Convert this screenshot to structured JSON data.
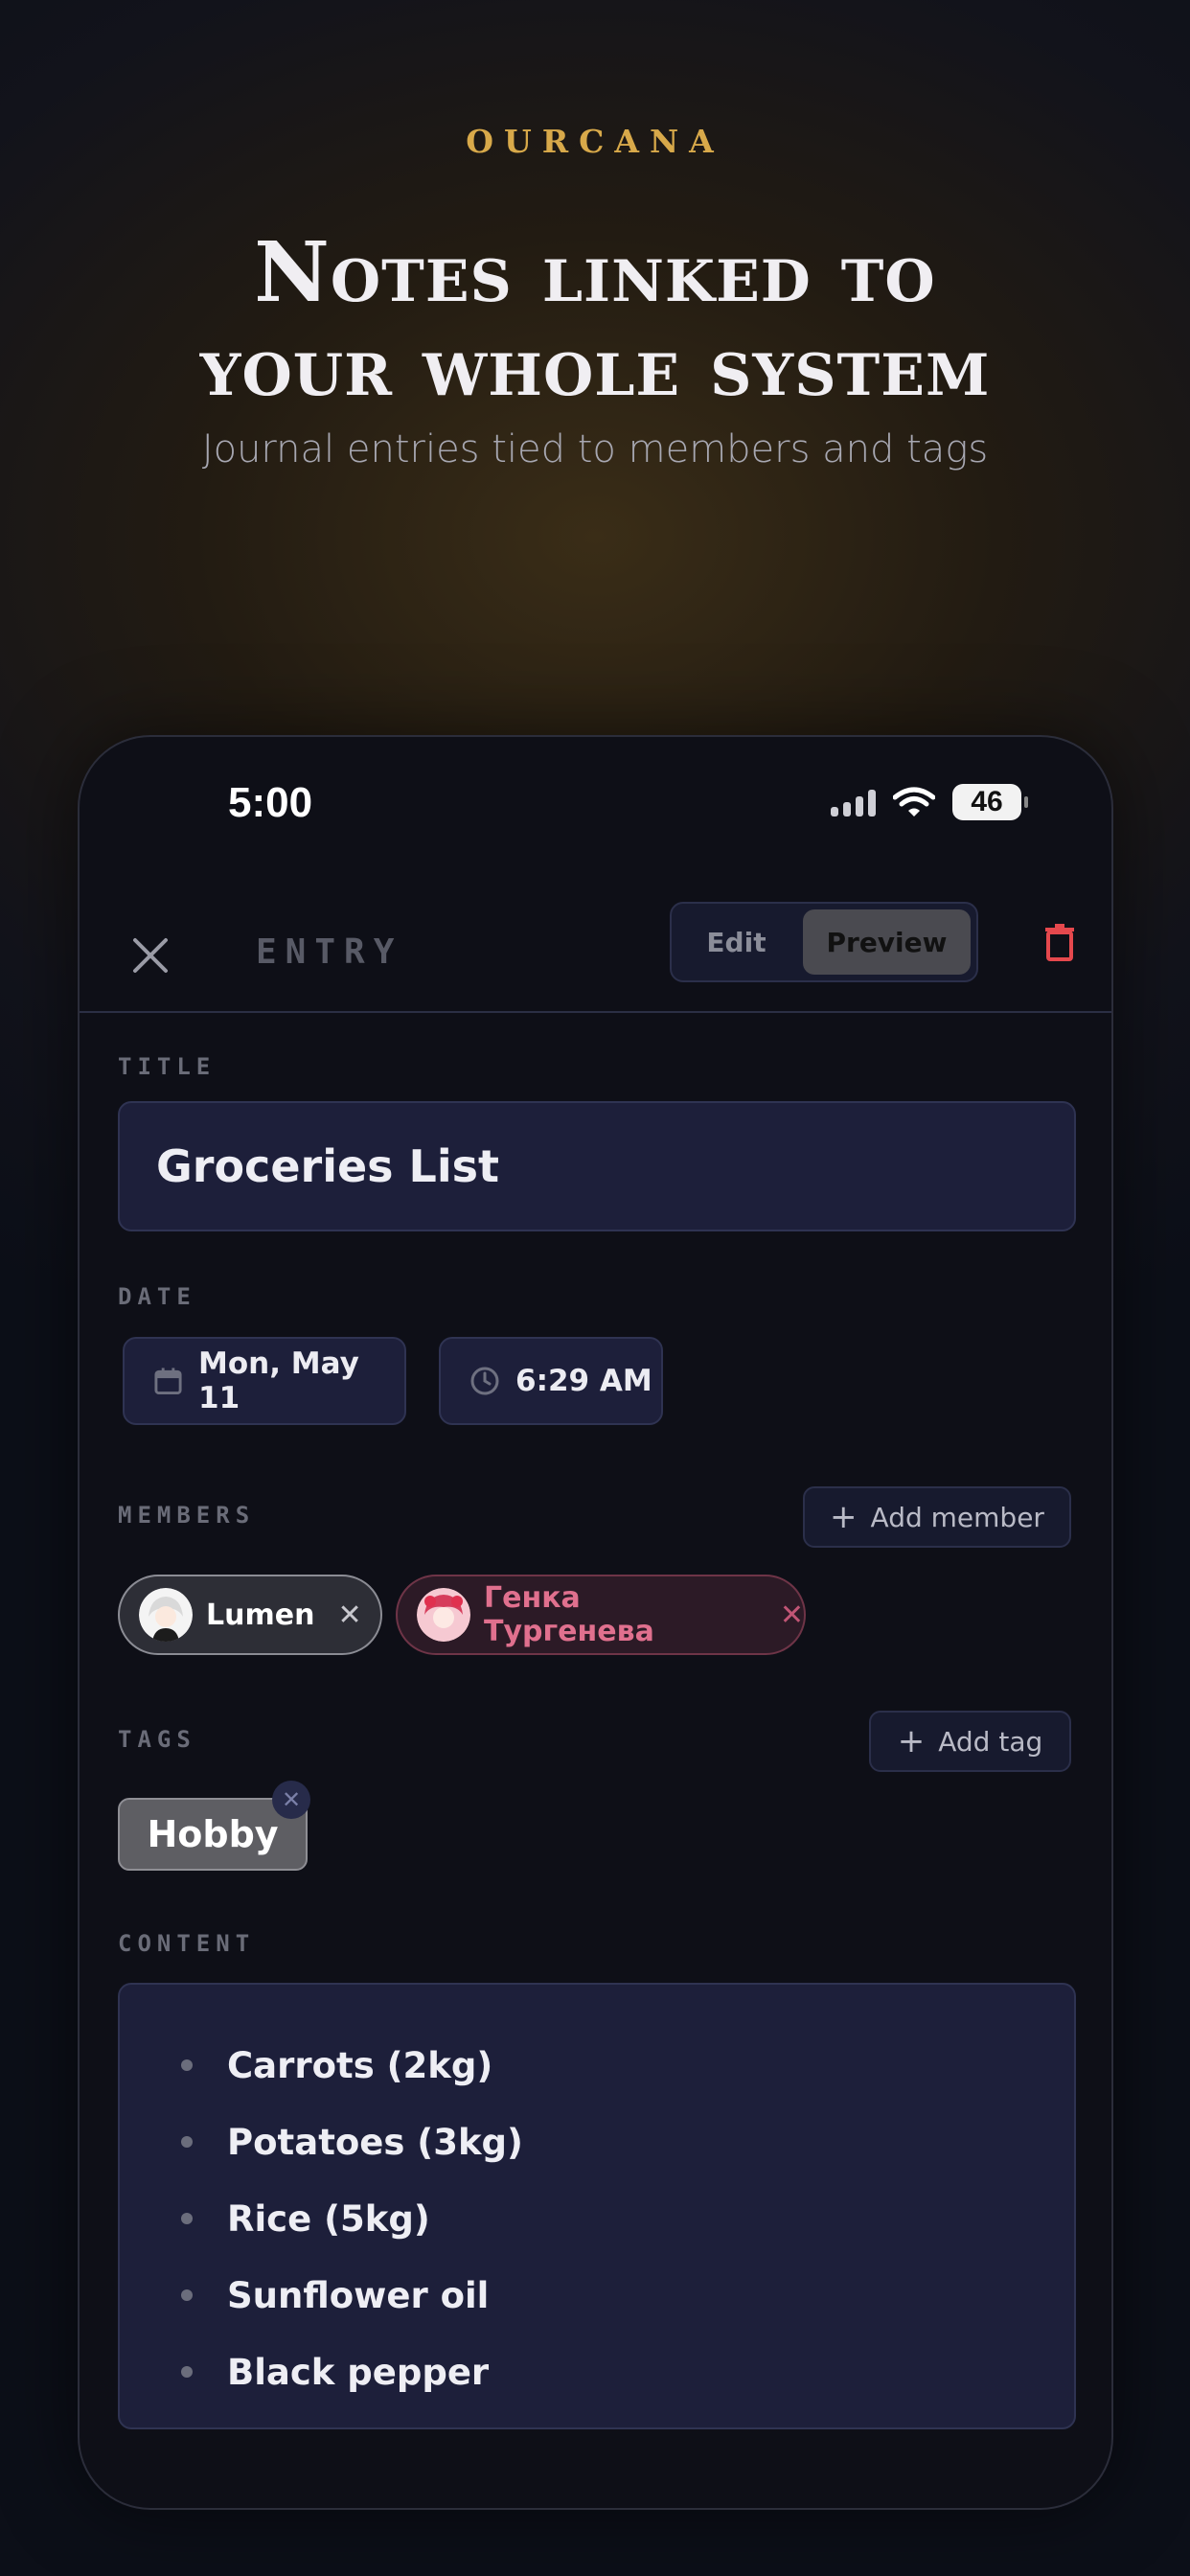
{
  "hero": {
    "brand": "OURCANA",
    "headline_line1": "Notes linked to",
    "headline_line2": "your whole system",
    "subhead": "Journal entries tied to members and tags"
  },
  "status_bar": {
    "time": "5:00",
    "battery": "46",
    "icons": [
      "signal-icon",
      "wifi-icon",
      "battery-icon"
    ]
  },
  "topbar": {
    "title": "ENTRY",
    "edit_label": "Edit",
    "preview_label": "Preview",
    "selected_mode": "Preview",
    "icons": [
      "close-icon",
      "trash-icon"
    ]
  },
  "title_section": {
    "label": "TITLE",
    "value": "Groceries List"
  },
  "date_section": {
    "label": "DATE",
    "date": "Mon, May 11",
    "time": "6:29 AM"
  },
  "members_section": {
    "label": "MEMBERS",
    "add_label": "Add member",
    "members": [
      {
        "name": "Lumen",
        "remove": "✕"
      },
      {
        "name": "Генка Тургенева",
        "remove": "✕"
      }
    ]
  },
  "tags_section": {
    "label": "TAGS",
    "add_label": "Add tag",
    "tags": [
      {
        "name": "Hobby",
        "remove": "✕"
      }
    ]
  },
  "content_section": {
    "label": "CONTENT",
    "items": [
      "Carrots (2kg)",
      "Potatoes (3kg)",
      "Rice (5kg)",
      "Sunflower oil",
      "Black pepper"
    ]
  },
  "colors": {
    "accent_gold": "#d8a94a",
    "danger_red": "#e5484d",
    "field_bg": "#1d1f3a",
    "member_pink": "#e0708e"
  }
}
